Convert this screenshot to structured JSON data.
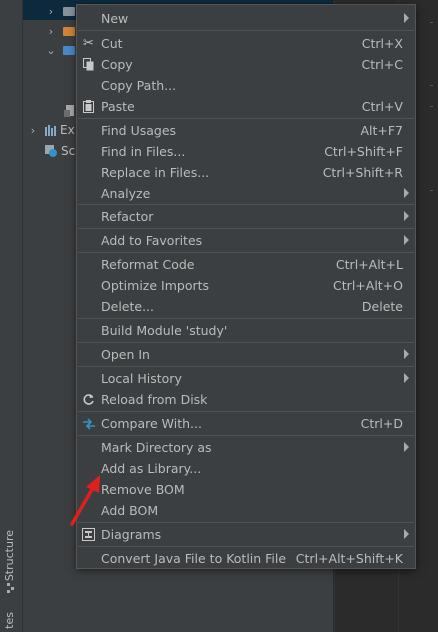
{
  "side_tabs": {
    "structure": "Structure",
    "favorites": "tes"
  },
  "project_tree": {
    "partial_labels": {
      "external": "Ex",
      "scratches": "Sc"
    }
  },
  "context_menu": {
    "items": {
      "new": {
        "label": "New",
        "submenu": true
      },
      "cut": {
        "label": "Cut",
        "shortcut": "Ctrl+X",
        "icon": "scissors-icon"
      },
      "copy": {
        "label": "Copy",
        "shortcut": "Ctrl+C",
        "icon": "copy-icon"
      },
      "copy_path": {
        "label": "Copy Path..."
      },
      "paste": {
        "label": "Paste",
        "shortcut": "Ctrl+V",
        "icon": "clipboard-icon"
      },
      "find_usages": {
        "label": "Find Usages",
        "shortcut": "Alt+F7"
      },
      "find_in_files": {
        "label": "Find in Files...",
        "shortcut": "Ctrl+Shift+F"
      },
      "replace_in_files": {
        "label": "Replace in Files...",
        "shortcut": "Ctrl+Shift+R"
      },
      "analyze": {
        "label": "Analyze",
        "submenu": true
      },
      "refactor": {
        "label": "Refactor",
        "submenu": true
      },
      "add_to_favorites": {
        "label": "Add to Favorites",
        "submenu": true
      },
      "reformat_code": {
        "label": "Reformat Code",
        "shortcut": "Ctrl+Alt+L"
      },
      "optimize_imports": {
        "label": "Optimize Imports",
        "shortcut": "Ctrl+Alt+O"
      },
      "delete": {
        "label": "Delete...",
        "shortcut": "Delete"
      },
      "build_module": {
        "label": "Build Module 'study'"
      },
      "open_in": {
        "label": "Open In",
        "submenu": true
      },
      "local_history": {
        "label": "Local History",
        "submenu": true
      },
      "reload_from_disk": {
        "label": "Reload from Disk",
        "icon": "reload-icon"
      },
      "compare_with": {
        "label": "Compare With...",
        "shortcut": "Ctrl+D",
        "icon": "compare-arrows-icon"
      },
      "mark_directory_as": {
        "label": "Mark Directory as",
        "submenu": true
      },
      "add_as_library": {
        "label": "Add as Library..."
      },
      "remove_bom": {
        "label": "Remove BOM"
      },
      "add_bom": {
        "label": "Add BOM"
      },
      "diagrams": {
        "label": "Diagrams",
        "submenu": true,
        "icon": "diagram-icon"
      },
      "convert_java_kotlin": {
        "label": "Convert Java File to Kotlin File",
        "shortcut": "Ctrl+Alt+Shift+K"
      }
    }
  },
  "colors": {
    "menu_bg": "#3c3f41",
    "menu_text": "#bbbbbb",
    "selection": "#0d293e",
    "annotation_arrow": "#e0201e"
  }
}
